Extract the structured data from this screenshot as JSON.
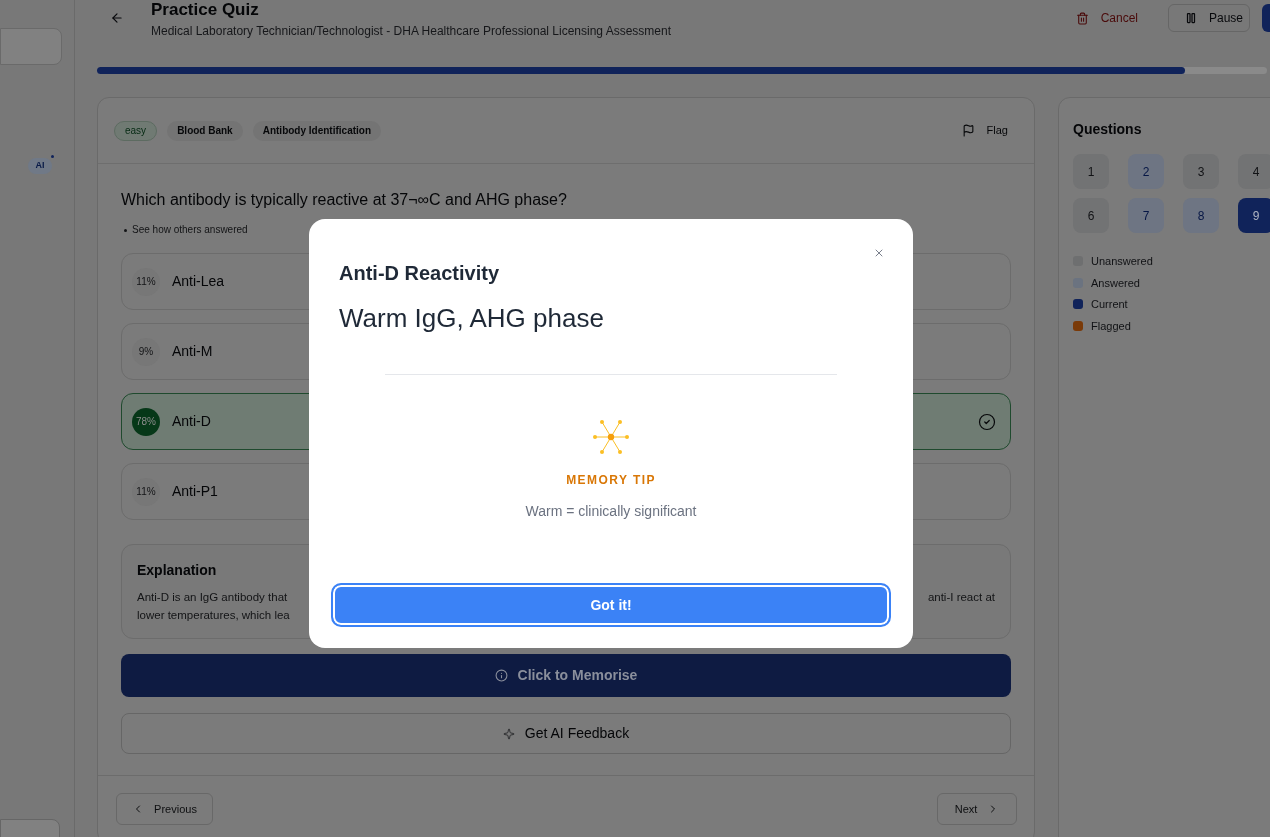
{
  "sidebar": {
    "badge": "AI"
  },
  "header": {
    "title": "Practice Quiz",
    "subtitle": "Medical Laboratory Technician/Technologist - DHA Healthcare Professional Licensing Assessment",
    "actions": [
      {
        "kind": "cancel",
        "label": "Cancel"
      },
      {
        "kind": "pause",
        "label": "Pause"
      },
      {
        "kind": "primary"
      }
    ]
  },
  "progress": {
    "level": 0.93
  },
  "question_card": {
    "tags": [
      {
        "kind": "difficulty",
        "label": "easy"
      },
      {
        "kind": "topic",
        "label": "Blood Bank"
      },
      {
        "kind": "topic",
        "label": "Antibody Identification"
      }
    ],
    "flag": {
      "label": "Flag"
    },
    "question": "Which antibody is typically reactive at 37¬∞C and AHG phase?",
    "hint": "See how others answered",
    "options": [
      {
        "share": "11%",
        "label": "Anti-Lea",
        "correct": false
      },
      {
        "share": "9%",
        "label": "Anti-M",
        "correct": false
      },
      {
        "share": "78%",
        "label": "Anti-D",
        "correct": true
      },
      {
        "share": "11%",
        "label": "Anti-P1",
        "correct": false
      }
    ],
    "explanation": {
      "title": "Explanation",
      "lines": [
        {
          "left": "Anti-D is an IgG antibody that",
          "right": "anti-I react at"
        },
        {
          "left": "lower temperatures, which lea"
        }
      ]
    },
    "memorise_button": "Click to Memorise",
    "ai_button": "Get AI Feedback",
    "nav": {
      "previous": "Previous",
      "next": "Next"
    }
  },
  "questions_panel": {
    "title": "Questions",
    "items": [
      {
        "label": "1",
        "answered": false,
        "selected": false
      },
      {
        "label": "2",
        "answered": true,
        "selected": false
      },
      {
        "label": "3",
        "answered": false,
        "selected": false
      },
      {
        "label": "4",
        "answered": false,
        "selected": false
      },
      {
        "label": "6",
        "answered": false,
        "selected": false
      },
      {
        "label": "7",
        "answered": true,
        "selected": false
      },
      {
        "label": "8",
        "answered": true,
        "selected": false
      },
      {
        "label": "9",
        "answered": true,
        "selected": true
      }
    ],
    "legend": [
      {
        "label": "Unanswered",
        "color": "#6e6f70"
      },
      {
        "label": "Answered",
        "color": "#6b7380"
      },
      {
        "label": "Current",
        "color": "#10235a"
      },
      {
        "label": "Flagged",
        "color": "#7a3a08"
      }
    ]
  },
  "modal": {
    "title": "Anti-D Reactivity",
    "answer": "Warm IgG, AHG phase",
    "tip_label": "MEMORY TIP",
    "tip": "Warm = clinically significant",
    "button": "Got it!"
  }
}
